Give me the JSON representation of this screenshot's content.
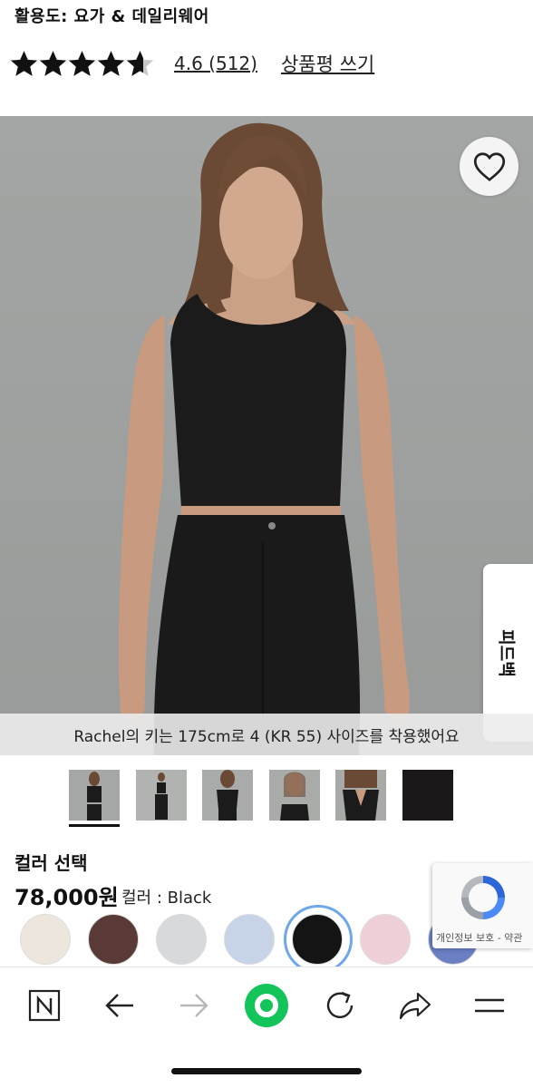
{
  "header": {
    "activity": "활용도: 요가 & 데일리웨어",
    "rating_text": "4.6 (512)",
    "write_review": "상품평 쓰기",
    "stars": 4.6
  },
  "hero": {
    "caption": "Rachel의 키는 175cm로 4 (KR 55) 사이즈를 착용했어요",
    "feedback_tab": "피드백"
  },
  "product": {
    "color_section_label": "컬러 선택",
    "price": "78,000원",
    "color_name": "컬러 : Black",
    "swatches": [
      {
        "name": "cream",
        "color": "#ede6dc"
      },
      {
        "name": "brown",
        "color": "#5a3a36"
      },
      {
        "name": "light-grey",
        "color": "#d8d9db"
      },
      {
        "name": "light-blue",
        "color": "#c7d3e6"
      },
      {
        "name": "black",
        "color": "#141414"
      },
      {
        "name": "pink",
        "color": "#efd0d6"
      },
      {
        "name": "blue",
        "color": "#6b7fc3"
      }
    ],
    "selected_swatch": "black"
  },
  "recaptcha": {
    "links": "개인정보 보호 - 약관"
  },
  "toolbar": {
    "icons": [
      "naver-n-icon",
      "back-arrow-icon",
      "forward-arrow-icon",
      "green-circle-icon",
      "refresh-icon",
      "share-icon",
      "menu-icon"
    ]
  },
  "colors": {
    "accent_ring": "#6ea8e8",
    "green_button": "#12c45a"
  }
}
